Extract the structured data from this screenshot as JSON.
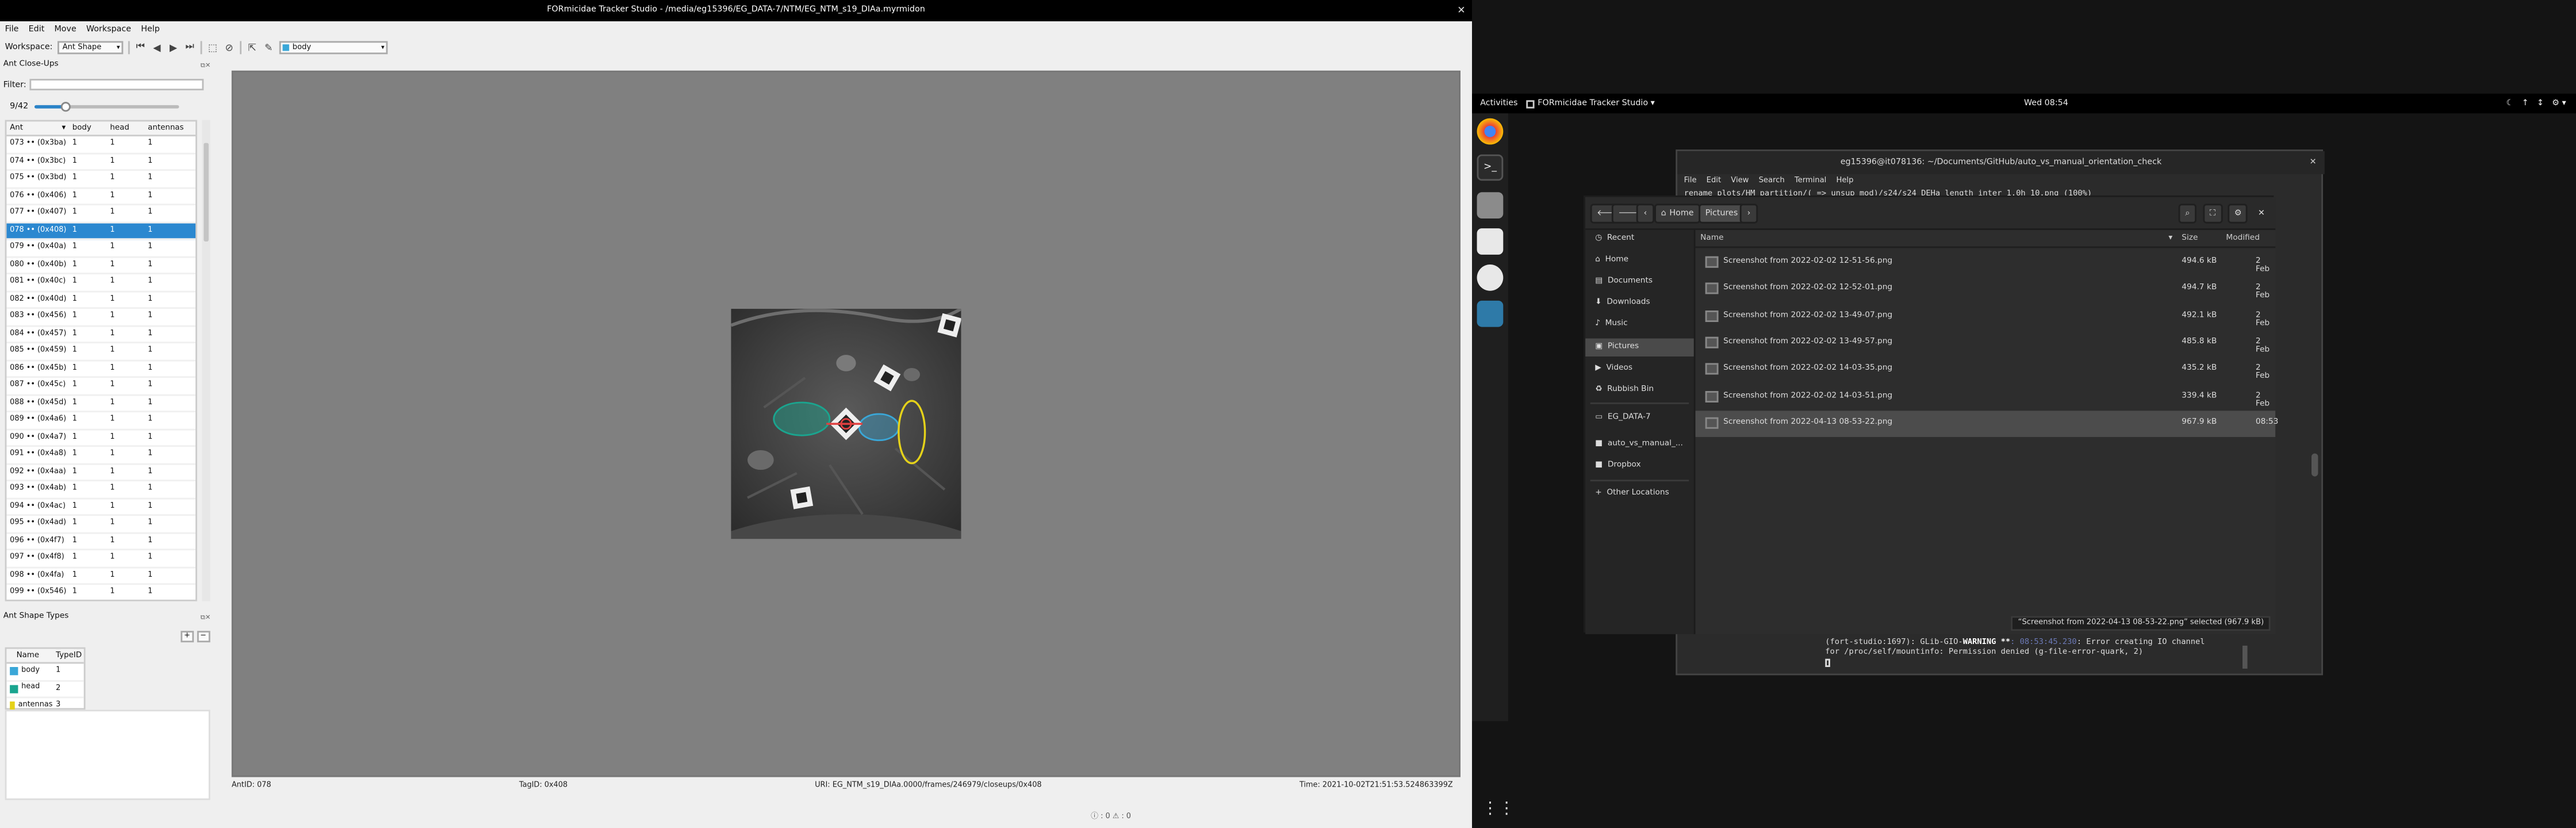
{
  "tracker": {
    "window_title": "FORmicidae Tracker Studio - /media/eg15396/EG_DATA-7/NTM/EG_NTM_s19_DIAa.myrmidon",
    "menu": [
      "File",
      "Edit",
      "Move",
      "Workspace",
      "Help"
    ],
    "workspace_label": "Workspace:",
    "workspace_value": "Ant Shape",
    "shape_selector": "body",
    "closeups_title": "Ant Close-Ups",
    "filter_label": "Filter:",
    "frame_counter": "9/42",
    "frame_progress": 0.21,
    "table_headers": [
      "Ant",
      "body",
      "head",
      "antennas"
    ],
    "ants": [
      {
        "ant": "073 •• (0x3ba)",
        "body": "1",
        "head": "1",
        "antennas": "1"
      },
      {
        "ant": "074 •• (0x3bc)",
        "body": "1",
        "head": "1",
        "antennas": "1"
      },
      {
        "ant": "075 •• (0x3bd)",
        "body": "1",
        "head": "1",
        "antennas": "1"
      },
      {
        "ant": "076 •• (0x406)",
        "body": "1",
        "head": "1",
        "antennas": "1"
      },
      {
        "ant": "077 •• (0x407)",
        "body": "1",
        "head": "1",
        "antennas": "1"
      },
      {
        "ant": "078 •• (0x408)",
        "body": "1",
        "head": "1",
        "antennas": "1"
      },
      {
        "ant": "079 •• (0x40a)",
        "body": "1",
        "head": "1",
        "antennas": "1"
      },
      {
        "ant": "080 •• (0x40b)",
        "body": "1",
        "head": "1",
        "antennas": "1"
      },
      {
        "ant": "081 •• (0x40c)",
        "body": "1",
        "head": "1",
        "antennas": "1"
      },
      {
        "ant": "082 •• (0x40d)",
        "body": "1",
        "head": "1",
        "antennas": "1"
      },
      {
        "ant": "083 •• (0x456)",
        "body": "1",
        "head": "1",
        "antennas": "1"
      },
      {
        "ant": "084 •• (0x457)",
        "body": "1",
        "head": "1",
        "antennas": "1"
      },
      {
        "ant": "085 •• (0x459)",
        "body": "1",
        "head": "1",
        "antennas": "1"
      },
      {
        "ant": "086 •• (0x45b)",
        "body": "1",
        "head": "1",
        "antennas": "1"
      },
      {
        "ant": "087 •• (0x45c)",
        "body": "1",
        "head": "1",
        "antennas": "1"
      },
      {
        "ant": "088 •• (0x45d)",
        "body": "1",
        "head": "1",
        "antennas": "1"
      },
      {
        "ant": "089 •• (0x4a6)",
        "body": "1",
        "head": "1",
        "antennas": "1"
      },
      {
        "ant": "090 •• (0x4a7)",
        "body": "1",
        "head": "1",
        "antennas": "1"
      },
      {
        "ant": "091 •• (0x4a8)",
        "body": "1",
        "head": "1",
        "antennas": "1"
      },
      {
        "ant": "092 •• (0x4aa)",
        "body": "1",
        "head": "1",
        "antennas": "1"
      },
      {
        "ant": "093 •• (0x4ab)",
        "body": "1",
        "head": "1",
        "antennas": "1"
      },
      {
        "ant": "094 •• (0x4ac)",
        "body": "1",
        "head": "1",
        "antennas": "1"
      },
      {
        "ant": "095 •• (0x4ad)",
        "body": "1",
        "head": "1",
        "antennas": "1"
      },
      {
        "ant": "096 •• (0x4f7)",
        "body": "1",
        "head": "1",
        "antennas": "1"
      },
      {
        "ant": "097 •• (0x4f8)",
        "body": "1",
        "head": "1",
        "antennas": "1"
      },
      {
        "ant": "098 •• (0x4fa)",
        "body": "1",
        "head": "1",
        "antennas": "1"
      },
      {
        "ant": "099 •• (0x546)",
        "body": "1",
        "head": "1",
        "antennas": "1"
      }
    ],
    "selected_ant_index": 5,
    "shape_types_title": "Ant Shape Types",
    "shape_headers": [
      "Name",
      "TypeID"
    ],
    "shape_types": [
      {
        "name": "body",
        "id": "1",
        "color": "#3aa7d8"
      },
      {
        "name": "head",
        "id": "2",
        "color": "#1aa58f"
      },
      {
        "name": "antennas",
        "id": "3",
        "color": "#e5d21a"
      }
    ],
    "status": {
      "ant_id": "AntID: 078",
      "tag_id": "TagID: 0x408",
      "uri": "URI: EG_NTM_s19_DIAa.0000/frames/246979/closeups/0x408",
      "time": "Time: 2021-10-02T21:51:53.524863399Z"
    },
    "bottom_status": "ⓘ : 0  ⚠ : 0"
  },
  "desktop": {
    "activities": "Activities",
    "topbar_app": "FORmicidae Tracker Studio ▾",
    "clock": "Wed 08:54",
    "tray": [
      "☾",
      "↑",
      "↕",
      "⚙ ▾"
    ]
  },
  "terminal": {
    "title": "eg15396@it078136: ~/Documents/GitHub/auto_vs_manual_orientation_check",
    "menu": [
      "File",
      "Edit",
      "View",
      "Search",
      "Terminal",
      "Help"
    ],
    "command": "rename plots/HM_partition/( => unsup_mod)/s24/s24_DEHa_length_inter_1.0h_10.png (100%)",
    "line1_prefix": "(fort-studio:1697): GLib-GIO-",
    "line1_warn": "WARNING **",
    "line1_time": ": 08:53:45.230",
    "line1_rest": ": Error creating IO channel",
    "line2": "for /proc/self/mountinfo: Permission denied (g-file-error-quark, 2)"
  },
  "files": {
    "path": [
      "Home",
      "Pictures"
    ],
    "sidebar": [
      "Recent",
      "Home",
      "Documents",
      "Downloads",
      "Music",
      "Pictures",
      "Videos",
      "Rubbish Bin",
      "EG_DATA-7",
      "auto_vs_manual_...",
      "Dropbox",
      "Other Locations"
    ],
    "sidebar_icons": [
      "◷",
      "⌂",
      "▤",
      "⬇",
      "♪",
      "▣",
      "▶",
      "♻",
      "▭",
      "■",
      "■",
      "+"
    ],
    "active_index": 5,
    "columns": [
      "Name",
      "Size",
      "Modified"
    ],
    "rows": [
      {
        "name": "Screenshot from 2022-02-02 12-51-56.png",
        "size": "494.6 kB",
        "modified": "2 Feb"
      },
      {
        "name": "Screenshot from 2022-02-02 12-52-01.png",
        "size": "494.7 kB",
        "modified": "2 Feb"
      },
      {
        "name": "Screenshot from 2022-02-02 13-49-07.png",
        "size": "492.1 kB",
        "modified": "2 Feb"
      },
      {
        "name": "Screenshot from 2022-02-02 13-49-57.png",
        "size": "485.8 kB",
        "modified": "2 Feb"
      },
      {
        "name": "Screenshot from 2022-02-02 14-03-35.png",
        "size": "435.2 kB",
        "modified": "2 Feb"
      },
      {
        "name": "Screenshot from 2022-02-02 14-03-51.png",
        "size": "339.4 kB",
        "modified": "2 Feb"
      },
      {
        "name": "Screenshot from 2022-04-13 08-53-22.png",
        "size": "967.9 kB",
        "modified": "08:53"
      }
    ],
    "selected_row": 6,
    "status": "“Screenshot from 2022-04-13 08-53-22.png” selected (967.9 kB)"
  }
}
